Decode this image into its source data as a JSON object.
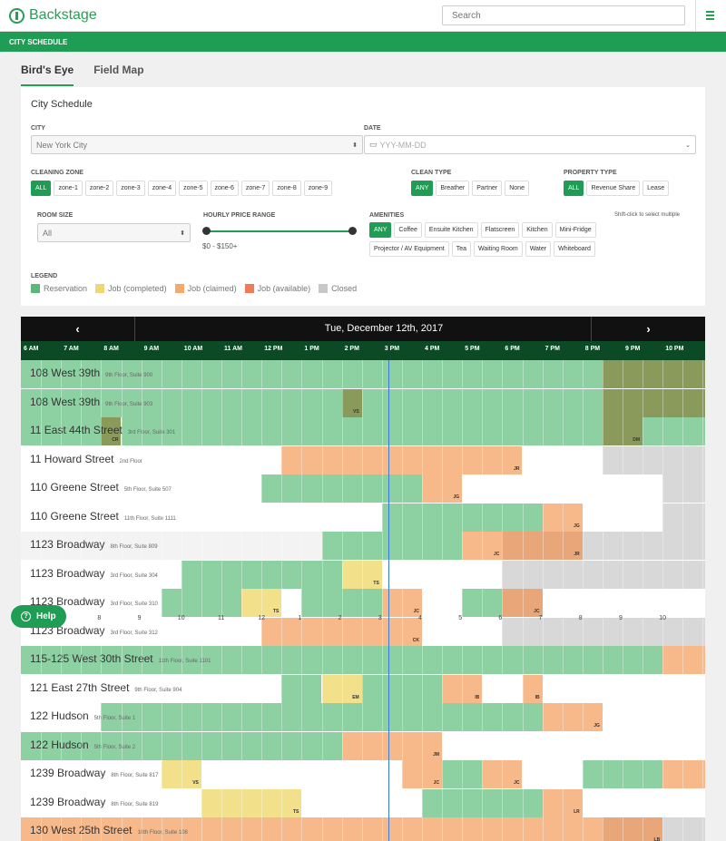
{
  "app": {
    "title": "Backstage"
  },
  "search": {
    "placeholder": "Search"
  },
  "greenbar": {
    "label": "CITY SCHEDULE"
  },
  "tabs": [
    {
      "label": "Bird's Eye"
    },
    {
      "label": "Field Map"
    }
  ],
  "panel": {
    "title": "City Schedule",
    "city": {
      "label": "CITY",
      "value": "New York City"
    },
    "date": {
      "label": "DATE",
      "placeholder": "YYY-MM-DD"
    },
    "cleaning_zone": {
      "label": "CLEANING ZONE",
      "options": [
        "ALL",
        "zone-1",
        "zone-2",
        "zone-3",
        "zone-4",
        "zone-5",
        "zone-6",
        "zone-7",
        "zone-8",
        "zone-9"
      ],
      "selected": "ALL"
    },
    "clean_type": {
      "label": "CLEAN TYPE",
      "options": [
        "ANY",
        "Breather",
        "Partner",
        "None"
      ],
      "selected": "ANY"
    },
    "property_type": {
      "label": "PROPERTY TYPE",
      "options": [
        "ALL",
        "Revenue Share",
        "Lease"
      ],
      "selected": "ALL"
    },
    "room_size": {
      "label": "ROOM SIZE",
      "value": "All"
    },
    "price": {
      "label": "HOURLY PRICE RANGE",
      "text": "$0 - $150+"
    },
    "amenities": {
      "label": "AMENITIES",
      "hint": "Shift-click to select multiple",
      "options": [
        "ANY",
        "Coffee",
        "Ensuite Kitchen",
        "Flatscreen",
        "Kitchen",
        "Mini-Fridge",
        "Projector / AV Equipment",
        "Tea",
        "Waiting Room",
        "Water",
        "Whiteboard"
      ],
      "selected": "ANY"
    },
    "legend": {
      "label": "LEGEND",
      "items": [
        {
          "label": "Reservation",
          "color": "#5cb87a"
        },
        {
          "label": "Job (completed)",
          "color": "#f0d674"
        },
        {
          "label": "Job (claimed)",
          "color": "#f5a96b"
        },
        {
          "label": "Job (available)",
          "color": "#ef7b5a"
        },
        {
          "label": "Closed",
          "color": "#c8c8c8"
        }
      ]
    }
  },
  "schedule": {
    "date": "Tue, December 12th, 2017",
    "prev_icon": "chevron-left-icon",
    "next_icon": "chevron-right-icon",
    "hours": [
      "6 AM",
      "7 AM",
      "8 AM",
      "9 AM",
      "10 AM",
      "11 AM",
      "12 PM",
      "1 PM",
      "2 PM",
      "3 PM",
      "4 PM",
      "5 PM",
      "6 PM",
      "7 PM",
      "8 PM",
      "9 PM",
      "10 PM"
    ],
    "ticks": [
      "8",
      "9",
      "10",
      "11",
      "12",
      "1",
      "2",
      "3",
      "4",
      "5",
      "6",
      "7",
      "8",
      "9",
      "10"
    ],
    "colors": {
      "R": "#8dd1a3",
      "RG": "#73c48f",
      "D": "#8a9a5a",
      "Y": "#f2e08a",
      "O": "#f7b98a",
      "DO": "#e9a679",
      "C": "#d8d8d8",
      "W": "#ffffff",
      "L": "#f3f3f3"
    },
    "rows": [
      {
        "name": "108 West 39th",
        "sub": "9th Floor, Suite 900",
        "segments": [
          [
            "R",
            0,
            14.5
          ],
          [
            "D",
            14.5,
            17.5,
            "JA"
          ]
        ]
      },
      {
        "name": "108 West 39th",
        "sub": "9th Floor, Suite 903",
        "segments": [
          [
            "R",
            0,
            8
          ],
          [
            "D",
            8,
            8.5,
            "VS"
          ],
          [
            "R",
            8.5,
            14.5
          ],
          [
            "D",
            14.5,
            17.5,
            "JA"
          ]
        ]
      },
      {
        "name": "11 East 44th Street",
        "sub": "3rd Floor, Suite 301",
        "segments": [
          [
            "R",
            0,
            2
          ],
          [
            "D",
            2,
            2.5,
            "CR"
          ],
          [
            "R",
            2.5,
            14.5
          ],
          [
            "D",
            14.5,
            15.5,
            "DM"
          ],
          [
            "R",
            15.5,
            17.5
          ]
        ]
      },
      {
        "name": "11 Howard Street",
        "sub": "2nd Floor",
        "segments": [
          [
            "W",
            0,
            6.5
          ],
          [
            "O",
            6.5,
            12.5,
            "JR"
          ],
          [
            "W",
            12.5,
            14.5
          ],
          [
            "C",
            14.5,
            17.5
          ]
        ]
      },
      {
        "name": "110 Greene Street",
        "sub": "5th Floor, Suite 507",
        "segments": [
          [
            "W",
            0,
            6
          ],
          [
            "R",
            6,
            10
          ],
          [
            "O",
            10,
            11,
            "JG"
          ],
          [
            "W",
            11,
            16
          ],
          [
            "C",
            16,
            17.5
          ]
        ]
      },
      {
        "name": "110 Greene Street",
        "sub": "11th Floor, Suite 1111",
        "segments": [
          [
            "W",
            0,
            9
          ],
          [
            "R",
            9,
            13
          ],
          [
            "O",
            13,
            14,
            "JG"
          ],
          [
            "W",
            14,
            16
          ],
          [
            "C",
            16,
            17.5
          ]
        ]
      },
      {
        "name": "1123 Broadway",
        "sub": "8th Floor, Suite 809",
        "segments": [
          [
            "L",
            0,
            7.5
          ],
          [
            "R",
            7.5,
            11
          ],
          [
            "O",
            11,
            12,
            "JC"
          ],
          [
            "DO",
            12,
            14,
            "JR"
          ],
          [
            "C",
            14,
            17.5
          ]
        ]
      },
      {
        "name": "1123 Broadway",
        "sub": "3rd Floor, Suite 304",
        "segments": [
          [
            "W",
            0,
            4
          ],
          [
            "R",
            4,
            8
          ],
          [
            "Y",
            8,
            9,
            "TS"
          ],
          [
            "W",
            9,
            12
          ],
          [
            "C",
            12,
            17.5
          ]
        ]
      },
      {
        "name": "1123 Broadway",
        "sub": "3rd Floor, Suite 310",
        "segments": [
          [
            "W",
            0,
            3.5
          ],
          [
            "R",
            3.5,
            5.5
          ],
          [
            "Y",
            5.5,
            6.5,
            "TS"
          ],
          [
            "W",
            6.5,
            7
          ],
          [
            "R",
            7,
            9
          ],
          [
            "O",
            9,
            10,
            "JC"
          ],
          [
            "W",
            10,
            11
          ],
          [
            "R",
            11,
            12
          ],
          [
            "DO",
            12,
            13,
            "JC"
          ],
          [
            "W",
            13,
            17.5
          ]
        ]
      },
      {
        "name": "1123 Broadway",
        "sub": "3rd Floor, Suite 312",
        "segments": [
          [
            "W",
            0,
            6
          ],
          [
            "O",
            6,
            10,
            "CK"
          ],
          [
            "W",
            10,
            12
          ],
          [
            "C",
            12,
            17.5
          ]
        ]
      },
      {
        "name": "115-125 West 30th Street",
        "sub": "11th Floor, Suite 1101",
        "segments": [
          [
            "R",
            0,
            16
          ],
          [
            "O",
            16,
            17.5,
            "IH"
          ]
        ]
      },
      {
        "name": "121 East 27th Street",
        "sub": "9th Floor, Suite 904",
        "segments": [
          [
            "W",
            0,
            6.5
          ],
          [
            "R",
            6.5,
            7.5
          ],
          [
            "Y",
            7.5,
            8.5,
            "EM"
          ],
          [
            "R",
            8.5,
            10.5
          ],
          [
            "O",
            10.5,
            11.5,
            "IB"
          ],
          [
            "W",
            11.5,
            12.5
          ],
          [
            "O",
            12.5,
            13,
            "IB"
          ],
          [
            "W",
            13,
            17.5
          ]
        ]
      },
      {
        "name": "122 Hudson",
        "sub": "5th Floor, Suite 1",
        "segments": [
          [
            "W",
            0,
            2
          ],
          [
            "R",
            2,
            13
          ],
          [
            "O",
            13,
            14.5,
            "JG"
          ],
          [
            "W",
            14.5,
            17.5
          ]
        ]
      },
      {
        "name": "122 Hudson",
        "sub": "5th Floor, Suite 2",
        "segments": [
          [
            "R",
            0,
            8
          ],
          [
            "O",
            8,
            10.5,
            "JM"
          ],
          [
            "W",
            10.5,
            17.5
          ]
        ]
      },
      {
        "name": "1239 Broadway",
        "sub": "8th Floor, Suite 817",
        "segments": [
          [
            "W",
            0,
            3.5
          ],
          [
            "Y",
            3.5,
            4.5,
            "VS"
          ],
          [
            "W",
            4.5,
            9.5
          ],
          [
            "O",
            9.5,
            10.5,
            "JC"
          ],
          [
            "R",
            10.5,
            11.5
          ],
          [
            "O",
            11.5,
            12.5,
            "JC"
          ],
          [
            "W",
            12.5,
            14
          ],
          [
            "R",
            14,
            16
          ],
          [
            "O",
            16,
            17.5,
            "JC"
          ]
        ]
      },
      {
        "name": "1239 Broadway",
        "sub": "8th Floor, Suite 819",
        "segments": [
          [
            "W",
            0,
            4.5
          ],
          [
            "Y",
            4.5,
            7,
            "TS"
          ],
          [
            "W",
            7,
            10
          ],
          [
            "R",
            10,
            13
          ],
          [
            "O",
            13,
            14,
            "LR"
          ],
          [
            "W",
            14,
            17.5
          ]
        ]
      },
      {
        "name": "130 West 25th Street",
        "sub": "10th Floor, Suite 108",
        "segments": [
          [
            "O",
            0,
            14.5
          ],
          [
            "DO",
            14.5,
            16,
            "LB"
          ],
          [
            "C",
            16,
            17.5
          ]
        ]
      }
    ]
  },
  "help": {
    "label": "Help"
  }
}
